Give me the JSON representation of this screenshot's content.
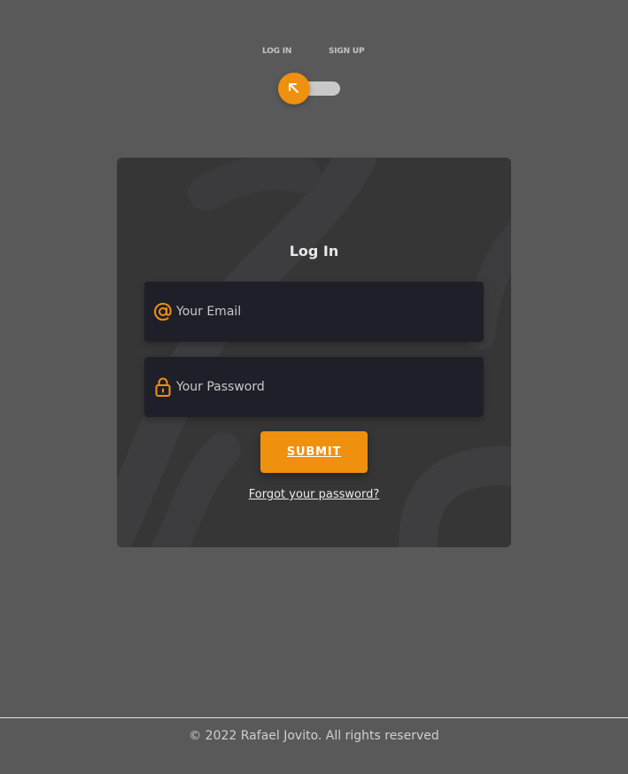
{
  "toggle": {
    "login_label": "LOG IN",
    "signup_label": "SIGN UP",
    "state": "login"
  },
  "login_form": {
    "title": "Log In",
    "email_placeholder": "Your Email",
    "password_placeholder": "Your Password",
    "submit_label": "SUBMIT",
    "forgot_label": "Forgot your password?"
  },
  "footer": {
    "copyright": "© 2022 Rafael Jovito. All rights reserved"
  },
  "colors": {
    "background": "#595959",
    "card": "#363636",
    "input": "#1f1f2a",
    "accent": "#f0900f",
    "toggle_track": "#c9c9c9"
  },
  "icons": {
    "toggle_knob": "arrow-up-left-icon",
    "email_field": "at-sign-icon",
    "password_field": "lock-icon"
  }
}
